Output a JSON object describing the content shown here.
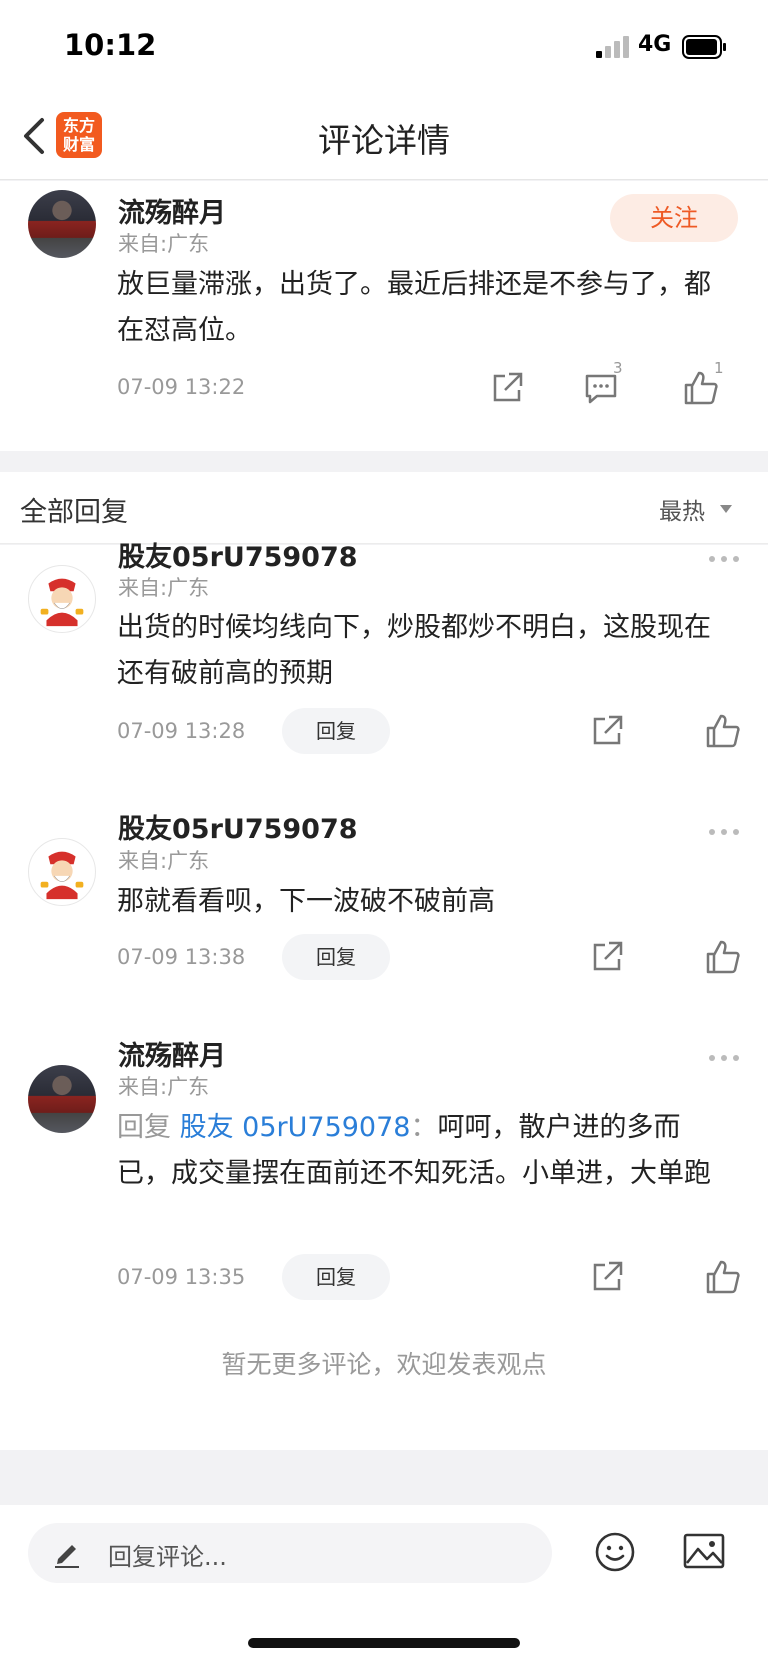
{
  "status": {
    "time": "10:12",
    "network": "4G"
  },
  "nav": {
    "title": "评论详情",
    "logo_line1": "东方",
    "logo_line2": "财富"
  },
  "main_comment": {
    "author": "流殇醉月",
    "location": "来自:广东",
    "follow_label": "关注",
    "text": "放巨量滞涨，出货了。最近后排还是不参与了，都在怼高位。",
    "time": "07-09 13:22",
    "reply_count": "3",
    "like_count": "1"
  },
  "section": {
    "title": "全部回复",
    "sort": "最热"
  },
  "replies": [
    {
      "author": "股友05rU759078",
      "location": "来自:广东",
      "text": "出货的时候均线向下，炒股都炒不明白，这股现在还有破前高的预期",
      "time": "07-09 13:28",
      "reply_label": "回复"
    },
    {
      "author": "股友05rU759078",
      "location": "来自:广东",
      "text": "那就看看呗，下一波破不破前高",
      "time": "07-09 13:38",
      "reply_label": "回复"
    },
    {
      "author": "流殇醉月",
      "location": "来自:广东",
      "prefix": "回复",
      "mention": "股友 05rU759078",
      "separator": "：",
      "text": "呵呵，散户进的多而已，成交量摆在面前还不知死活。小单进，大单跑",
      "time": "07-09 13:35",
      "reply_label": "回复"
    }
  ],
  "footer_note": "暂无更多评论，欢迎发表观点",
  "bottom": {
    "placeholder": "回复评论..."
  },
  "colors": {
    "accent": "#ee5a25",
    "link": "#2a7ed8",
    "muted": "#999999"
  }
}
